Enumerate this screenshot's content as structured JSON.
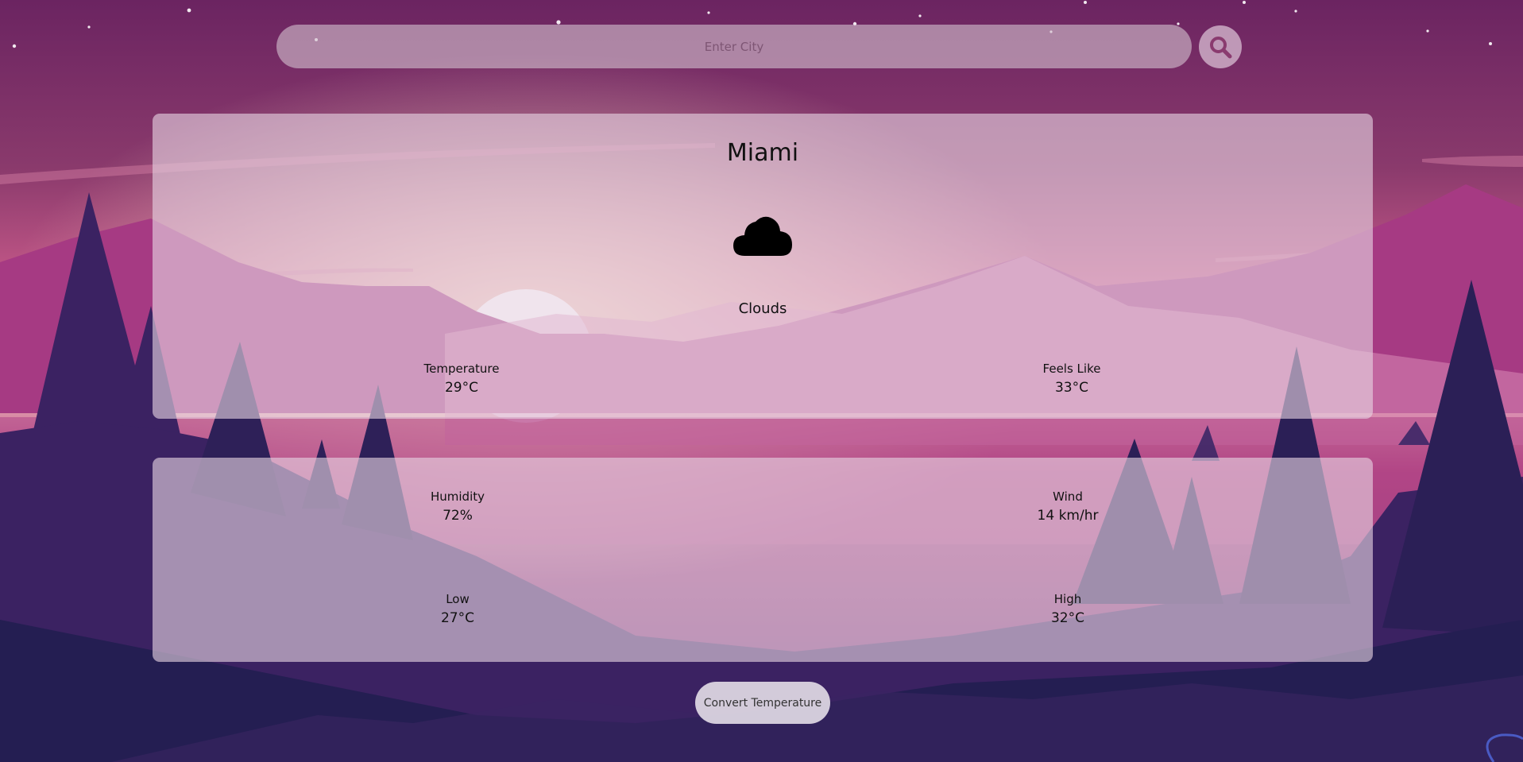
{
  "search": {
    "placeholder": "Enter City",
    "value": "",
    "button_icon": "search-icon"
  },
  "weather": {
    "city": "Miami",
    "icon": "cloud-icon",
    "condition": "Clouds",
    "temperature": {
      "label": "Temperature",
      "value": "29°C"
    },
    "feels_like": {
      "label": "Feels Like",
      "value": "33°C"
    }
  },
  "details": {
    "humidity": {
      "label": "Humidity",
      "value": "72%"
    },
    "wind": {
      "label": "Wind",
      "value": "14 km/hr"
    },
    "low": {
      "label": "Low",
      "value": "27°C"
    },
    "high": {
      "label": "High",
      "value": "32°C"
    }
  },
  "convert_button": {
    "label": "Convert Temperature"
  },
  "colors": {
    "sky_top": "#6b2461",
    "sky_mid": "#c0508a",
    "horizon_glow": "#f2c7b8",
    "mountain_far": "#a63a83",
    "mountain_near": "#3b2262",
    "foreground": "#231e52",
    "card_bg": "#e6d4e2",
    "text": "#111111"
  }
}
